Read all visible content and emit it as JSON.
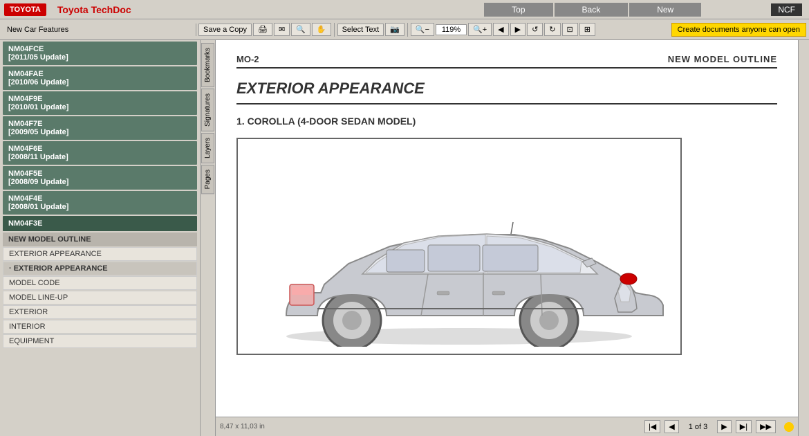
{
  "app": {
    "title": "Toyota TechDoc",
    "logo": "TOYOTA",
    "badge": "NCF"
  },
  "nav": {
    "top_btn": "Top",
    "back_btn": "Back",
    "new_btn": "New"
  },
  "toolbar": {
    "sidebar_header": "New Car Features",
    "save_copy": "Save a Copy",
    "select_text": "Select Text",
    "zoom_value": "119%",
    "create_doc": "Create documents anyone can open"
  },
  "side_tabs": [
    "Bookmarks",
    "Signatures",
    "Layers",
    "Pages"
  ],
  "sidebar": {
    "items": [
      {
        "id": "NM04FCE",
        "label": "NM04FCE",
        "sub": "[2011/05 Update]",
        "type": "green"
      },
      {
        "id": "NM04FAE",
        "label": "NM04FAE",
        "sub": "[2010/06 Update]",
        "type": "green"
      },
      {
        "id": "NM04F9E",
        "label": "NM04F9E",
        "sub": "[2010/01 Update]",
        "type": "green"
      },
      {
        "id": "NM04F7E",
        "label": "NM04F7E",
        "sub": "[2009/05 Update]",
        "type": "green"
      },
      {
        "id": "NM04F6E",
        "label": "NM04F6E",
        "sub": "[2008/11 Update]",
        "type": "green"
      },
      {
        "id": "NM04F5E",
        "label": "NM04F5E",
        "sub": "[2008/09 Update]",
        "type": "green"
      },
      {
        "id": "NM04F4E",
        "label": "NM04F4E",
        "sub": "[2008/01 Update]",
        "type": "green"
      },
      {
        "id": "NM04F3E",
        "label": "NM04F3E",
        "sub": "",
        "type": "active"
      }
    ],
    "sub_items": [
      {
        "label": "NEW MODEL OUTLINE",
        "type": "header"
      },
      {
        "label": "EXTERIOR APPEARANCE",
        "type": "sub"
      },
      {
        "label": "· EXTERIOR APPEARANCE",
        "type": "sub-active"
      },
      {
        "label": "MODEL CODE",
        "type": "sub"
      },
      {
        "label": "MODEL LINE-UP",
        "type": "sub"
      },
      {
        "label": "EXTERIOR",
        "type": "sub"
      },
      {
        "label": "INTERIOR",
        "type": "sub"
      },
      {
        "label": "EQUIPMENT",
        "type": "sub"
      }
    ]
  },
  "document": {
    "mo_label": "MO-2",
    "section_label": "NEW MODEL OUTLINE",
    "main_title": "EXTERIOR APPEARANCE",
    "sub_title": "1.  COROLLA (4-DOOR SEDAN MODEL)"
  },
  "bottom_bar": {
    "dimensions": "8,47 x 11,03 in",
    "page_info": "1 of 3"
  },
  "colors": {
    "green_sidebar": "#5a7a6a",
    "active_sidebar": "#3a5a4a",
    "toyota_red": "#cc0000",
    "header_bg": "#d4d0c8"
  }
}
